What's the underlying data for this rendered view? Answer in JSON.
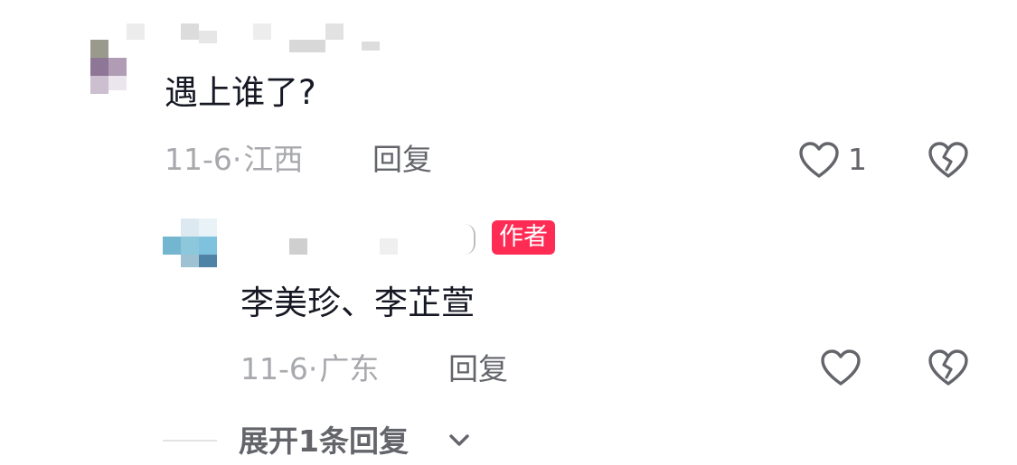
{
  "comment": {
    "text": "遇上谁了?",
    "date": "11-6",
    "separator": "·",
    "location": "江西",
    "reply_label": "回复",
    "like_count": "1"
  },
  "reply": {
    "author_badge": "作者",
    "text": "李美珍、李芷萱",
    "date": "11-6",
    "separator": "·",
    "location": "广东",
    "reply_label": "回复"
  },
  "expand": {
    "label": "展开1条回复"
  },
  "colors": {
    "badge": "#fe2c55",
    "meta": "#a8a9ad",
    "secondary": "#63656b",
    "text": "#161823"
  },
  "icons": {
    "like": "heart-outline-icon",
    "dislike": "broken-heart-icon",
    "expand": "chevron-down-icon"
  }
}
